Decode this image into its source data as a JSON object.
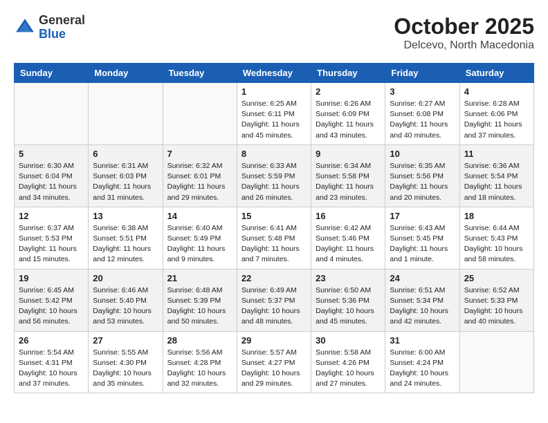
{
  "header": {
    "logo_general": "General",
    "logo_blue": "Blue",
    "title": "October 2025",
    "subtitle": "Delcevo, North Macedonia"
  },
  "weekdays": [
    "Sunday",
    "Monday",
    "Tuesday",
    "Wednesday",
    "Thursday",
    "Friday",
    "Saturday"
  ],
  "weeks": [
    [
      {
        "day": "",
        "info": ""
      },
      {
        "day": "",
        "info": ""
      },
      {
        "day": "",
        "info": ""
      },
      {
        "day": "1",
        "info": "Sunrise: 6:25 AM\nSunset: 6:11 PM\nDaylight: 11 hours and 45 minutes."
      },
      {
        "day": "2",
        "info": "Sunrise: 6:26 AM\nSunset: 6:09 PM\nDaylight: 11 hours and 43 minutes."
      },
      {
        "day": "3",
        "info": "Sunrise: 6:27 AM\nSunset: 6:08 PM\nDaylight: 11 hours and 40 minutes."
      },
      {
        "day": "4",
        "info": "Sunrise: 6:28 AM\nSunset: 6:06 PM\nDaylight: 11 hours and 37 minutes."
      }
    ],
    [
      {
        "day": "5",
        "info": "Sunrise: 6:30 AM\nSunset: 6:04 PM\nDaylight: 11 hours and 34 minutes."
      },
      {
        "day": "6",
        "info": "Sunrise: 6:31 AM\nSunset: 6:03 PM\nDaylight: 11 hours and 31 minutes."
      },
      {
        "day": "7",
        "info": "Sunrise: 6:32 AM\nSunset: 6:01 PM\nDaylight: 11 hours and 29 minutes."
      },
      {
        "day": "8",
        "info": "Sunrise: 6:33 AM\nSunset: 5:59 PM\nDaylight: 11 hours and 26 minutes."
      },
      {
        "day": "9",
        "info": "Sunrise: 6:34 AM\nSunset: 5:58 PM\nDaylight: 11 hours and 23 minutes."
      },
      {
        "day": "10",
        "info": "Sunrise: 6:35 AM\nSunset: 5:56 PM\nDaylight: 11 hours and 20 minutes."
      },
      {
        "day": "11",
        "info": "Sunrise: 6:36 AM\nSunset: 5:54 PM\nDaylight: 11 hours and 18 minutes."
      }
    ],
    [
      {
        "day": "12",
        "info": "Sunrise: 6:37 AM\nSunset: 5:53 PM\nDaylight: 11 hours and 15 minutes."
      },
      {
        "day": "13",
        "info": "Sunrise: 6:38 AM\nSunset: 5:51 PM\nDaylight: 11 hours and 12 minutes."
      },
      {
        "day": "14",
        "info": "Sunrise: 6:40 AM\nSunset: 5:49 PM\nDaylight: 11 hours and 9 minutes."
      },
      {
        "day": "15",
        "info": "Sunrise: 6:41 AM\nSunset: 5:48 PM\nDaylight: 11 hours and 7 minutes."
      },
      {
        "day": "16",
        "info": "Sunrise: 6:42 AM\nSunset: 5:46 PM\nDaylight: 11 hours and 4 minutes."
      },
      {
        "day": "17",
        "info": "Sunrise: 6:43 AM\nSunset: 5:45 PM\nDaylight: 11 hours and 1 minute."
      },
      {
        "day": "18",
        "info": "Sunrise: 6:44 AM\nSunset: 5:43 PM\nDaylight: 10 hours and 58 minutes."
      }
    ],
    [
      {
        "day": "19",
        "info": "Sunrise: 6:45 AM\nSunset: 5:42 PM\nDaylight: 10 hours and 56 minutes."
      },
      {
        "day": "20",
        "info": "Sunrise: 6:46 AM\nSunset: 5:40 PM\nDaylight: 10 hours and 53 minutes."
      },
      {
        "day": "21",
        "info": "Sunrise: 6:48 AM\nSunset: 5:39 PM\nDaylight: 10 hours and 50 minutes."
      },
      {
        "day": "22",
        "info": "Sunrise: 6:49 AM\nSunset: 5:37 PM\nDaylight: 10 hours and 48 minutes."
      },
      {
        "day": "23",
        "info": "Sunrise: 6:50 AM\nSunset: 5:36 PM\nDaylight: 10 hours and 45 minutes."
      },
      {
        "day": "24",
        "info": "Sunrise: 6:51 AM\nSunset: 5:34 PM\nDaylight: 10 hours and 42 minutes."
      },
      {
        "day": "25",
        "info": "Sunrise: 6:52 AM\nSunset: 5:33 PM\nDaylight: 10 hours and 40 minutes."
      }
    ],
    [
      {
        "day": "26",
        "info": "Sunrise: 5:54 AM\nSunset: 4:31 PM\nDaylight: 10 hours and 37 minutes."
      },
      {
        "day": "27",
        "info": "Sunrise: 5:55 AM\nSunset: 4:30 PM\nDaylight: 10 hours and 35 minutes."
      },
      {
        "day": "28",
        "info": "Sunrise: 5:56 AM\nSunset: 4:28 PM\nDaylight: 10 hours and 32 minutes."
      },
      {
        "day": "29",
        "info": "Sunrise: 5:57 AM\nSunset: 4:27 PM\nDaylight: 10 hours and 29 minutes."
      },
      {
        "day": "30",
        "info": "Sunrise: 5:58 AM\nSunset: 4:26 PM\nDaylight: 10 hours and 27 minutes."
      },
      {
        "day": "31",
        "info": "Sunrise: 6:00 AM\nSunset: 4:24 PM\nDaylight: 10 hours and 24 minutes."
      },
      {
        "day": "",
        "info": ""
      }
    ]
  ]
}
